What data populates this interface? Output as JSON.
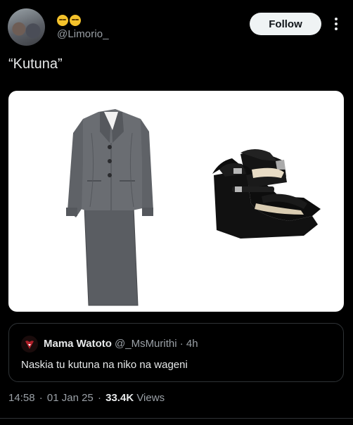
{
  "author": {
    "emoji_icon": "pensive-face-emoji",
    "handle": "@Limorio_"
  },
  "header": {
    "follow_label": "Follow",
    "more_icon": "more-vertical-icon"
  },
  "tweet": {
    "text": "“Kutuna”"
  },
  "media": {
    "description_icons": [
      "grey-skirt-suit-image",
      "black-wedge-sandals-image"
    ]
  },
  "quote": {
    "name": "Mama Watoto",
    "handle": "@_MsMurithi",
    "time": "4h",
    "text": "Naskia tu kutuna na niko na wageni"
  },
  "meta": {
    "time": "14:58",
    "date": "01 Jan 25",
    "views_count": "33.4K",
    "views_label": "Views"
  },
  "colors": {
    "background": "#000000",
    "text": "#e7e9ea",
    "secondary_text": "#9aa0a6",
    "follow_button": "#eff3f4",
    "border": "#2f3336"
  }
}
